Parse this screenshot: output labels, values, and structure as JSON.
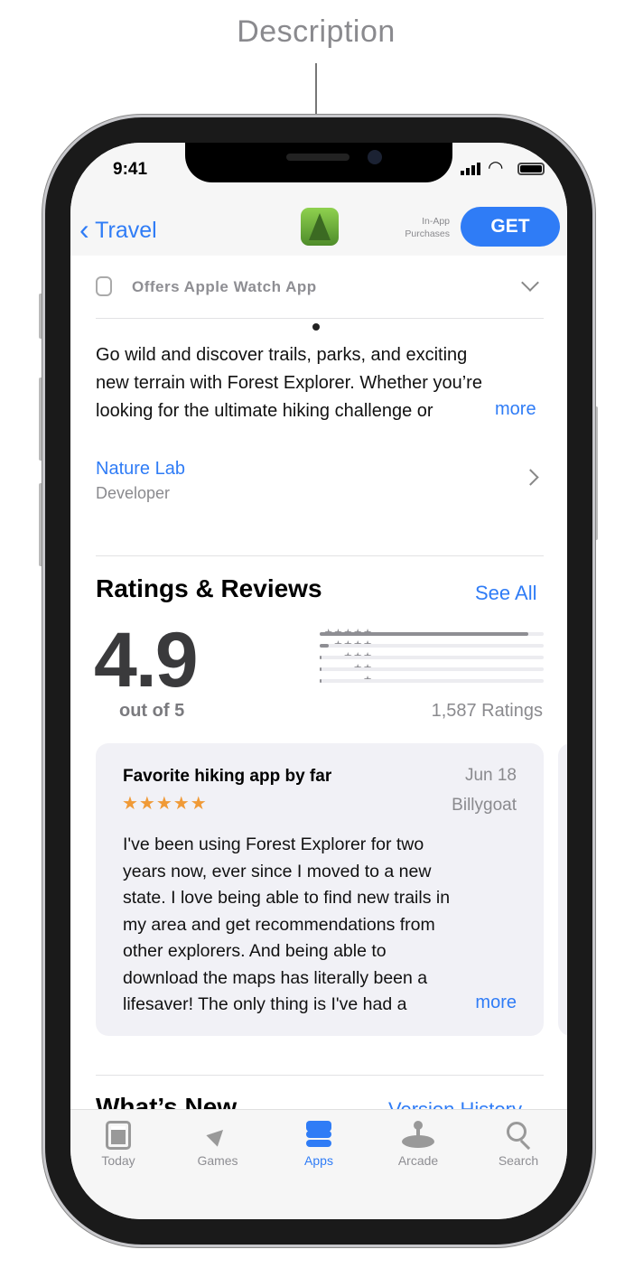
{
  "callout": {
    "label": "Description"
  },
  "status": {
    "time": "9:41"
  },
  "nav": {
    "back_label": "Travel",
    "iap_line1": "In-App",
    "iap_line2": "Purchases",
    "get_label": "GET"
  },
  "watch": {
    "label": "Offers Apple Watch App"
  },
  "description": {
    "lines": [
      "Go wild and discover trails, parks, and exciting",
      "new terrain with Forest Explorer. Whether you’re",
      "looking for the ultimate hiking challenge or"
    ],
    "more": "more"
  },
  "developer": {
    "name": "Nature Lab",
    "role": "Developer"
  },
  "ratings": {
    "title": "Ratings & Reviews",
    "see_all": "See All",
    "score": "4.9",
    "out_of": "out of 5",
    "count": "1,587 Ratings",
    "distribution": [
      {
        "stars": "★★★★★",
        "fraction": 0.93
      },
      {
        "stars": "★★★★",
        "fraction": 0.04
      },
      {
        "stars": "★★★",
        "fraction": 0.01
      },
      {
        "stars": "★★",
        "fraction": 0.01
      },
      {
        "stars": "★",
        "fraction": 0.01
      }
    ]
  },
  "review": {
    "title": "Favorite hiking app by far",
    "date": "Jun 18",
    "author": "Billygoat",
    "stars": "★★★★★",
    "lines": [
      "I've been using Forest Explorer for two",
      "years now, ever since I moved to a new",
      "state. I love being able to find new trails in",
      "my area and get recommendations from",
      "other explorers. And being able to",
      "download the maps has literally been a",
      "lifesaver! The only thing is I've had a"
    ],
    "more": "more"
  },
  "whats_new": {
    "title": "What’s New",
    "version_history": "Version History"
  },
  "tabs": [
    {
      "label": "Today",
      "icon": "today-icon"
    },
    {
      "label": "Games",
      "icon": "rocket-icon"
    },
    {
      "label": "Apps",
      "icon": "layers-icon",
      "active": true
    },
    {
      "label": "Arcade",
      "icon": "joystick-icon"
    },
    {
      "label": "Search",
      "icon": "search-icon"
    }
  ],
  "colors": {
    "accent": "#2f7cf6",
    "star": "#f09a37"
  }
}
